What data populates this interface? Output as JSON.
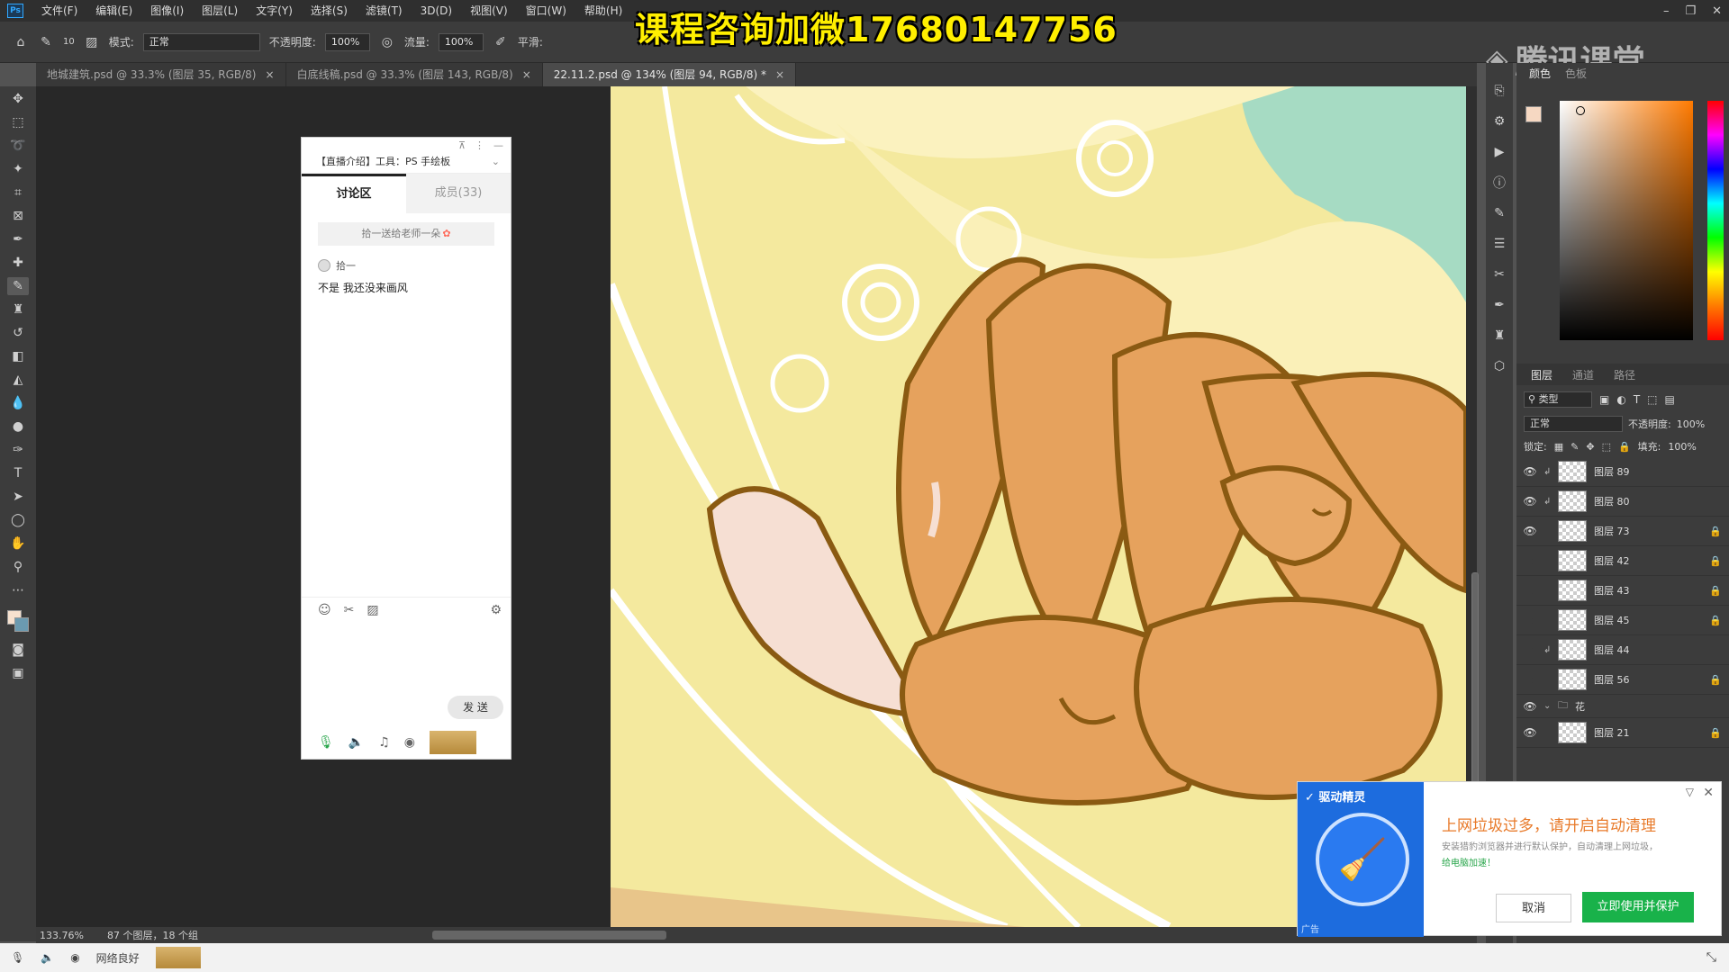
{
  "menubar": {
    "items": [
      "文件(F)",
      "编辑(E)",
      "图像(I)",
      "图层(L)",
      "文字(Y)",
      "选择(S)",
      "滤镜(T)",
      "3D(D)",
      "视图(V)",
      "窗口(W)",
      "帮助(H)"
    ]
  },
  "overlay": {
    "watermark": "课程咨询加微17680147756",
    "brand": "腾讯课堂"
  },
  "options": {
    "brush_size": "10",
    "mode_label": "模式:",
    "mode_value": "正常",
    "opacity_label": "不透明度:",
    "opacity_value": "100%",
    "flow_label": "流量:",
    "flow_value": "100%",
    "smooth_label": "平滑:"
  },
  "tabs": [
    {
      "label": "地城建筑.psd @ 33.3% (图层 35, RGB/8)",
      "close": "×"
    },
    {
      "label": "白底线稿.psd @ 33.3% (图层 143, RGB/8)",
      "close": "×"
    },
    {
      "label": "22.11.2.psd @ 134% (图层 94, RGB/8) *",
      "close": "×"
    }
  ],
  "status": {
    "zoom": "133.76%",
    "info": "87 个图层，18 个组"
  },
  "chat": {
    "title": "【直播介绍】工具：PS 手绘板",
    "tab_discussion": "讨论区",
    "tab_members": "成员(33)",
    "gift_text": "拾一送给老师一朵",
    "message_user": "拾一",
    "message_text": "不是 我还没来画风",
    "send_label": "发 送"
  },
  "color_panel": {
    "tab_color": "颜色",
    "tab_swatches": "色板"
  },
  "layers_panel": {
    "tab_layers": "图层",
    "tab_channels": "通道",
    "tab_paths": "路径",
    "filter_label": "类型",
    "blend_mode": "正常",
    "opacity_label": "不透明度:",
    "opacity_value": "100%",
    "lock_label": "锁定:",
    "fill_label": "填充:",
    "fill_value": "100%",
    "layers": [
      {
        "name": "图层 89",
        "visible": true,
        "clipped": true,
        "locked": false
      },
      {
        "name": "图层 80",
        "visible": true,
        "clipped": true,
        "locked": false
      },
      {
        "name": "图层 73",
        "visible": true,
        "clipped": false,
        "locked": true
      },
      {
        "name": "图层 42",
        "visible": false,
        "clipped": false,
        "locked": true
      },
      {
        "name": "图层 43",
        "visible": false,
        "clipped": false,
        "locked": true
      },
      {
        "name": "图层 45",
        "visible": false,
        "clipped": false,
        "locked": true
      },
      {
        "name": "图层 44",
        "visible": false,
        "clipped": true,
        "locked": false
      },
      {
        "name": "图层 56",
        "visible": false,
        "clipped": false,
        "locked": true
      }
    ],
    "group_name": "花",
    "layer_after_group": "图层 21"
  },
  "ad": {
    "brand": "驱动精灵",
    "tag": "广告",
    "title": "上网垃圾过多，请开启自动清理",
    "desc": "安装猎豹浏览器并进行默认保护，自动清理上网垃圾，",
    "desc_link": "给电脑加速！",
    "cancel": "取消",
    "ok": "立即使用并保护"
  },
  "sysbar": {
    "network": "网络良好"
  }
}
